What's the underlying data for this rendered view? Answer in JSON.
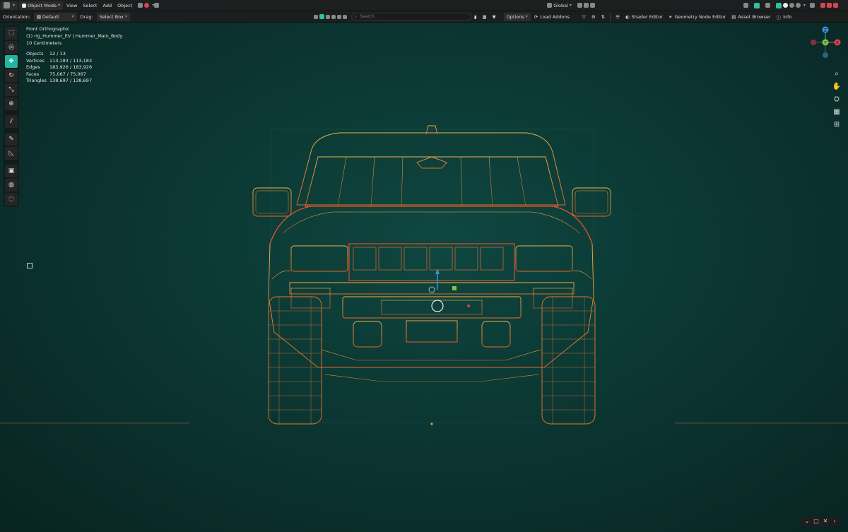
{
  "topbar": {
    "mode": "Object Mode",
    "menus": [
      "View",
      "Select",
      "Add",
      "Object"
    ],
    "transform_orientation": "Global"
  },
  "toolrow": {
    "orientation_label": "Orientation:",
    "orientation_value": "Default",
    "drag_label": "Drag:",
    "drag_value": "Select Box",
    "search_placeholder": "Search",
    "options_label": "Options",
    "load_addons": "Load Addons",
    "shader_editor": "Shader Editor",
    "geometry_node_editor": "Geometry Node Editor",
    "asset_browser": "Asset Browser",
    "info": "Info"
  },
  "overlay": {
    "view_name": "Front Orthographic",
    "object_path": "(1) rig_Hummer_EV | Hummer_Main_Body",
    "scale": "10 Centimeters"
  },
  "stats": [
    {
      "label": "Objects",
      "value": "12 / 13"
    },
    {
      "label": "Vertices",
      "value": "113,183 / 113,183"
    },
    {
      "label": "Edges",
      "value": "183,926 / 183,926"
    },
    {
      "label": "Faces",
      "value": "75,067 / 75,067"
    },
    {
      "label": "Triangles",
      "value": "138,697 / 138,697"
    }
  ],
  "gizmo_axes": {
    "x": "X",
    "y": "Y",
    "z": "Z"
  },
  "colors": {
    "accent": "#1fb5a0",
    "wire": "#f0a040",
    "wire_hot": "#e8542a",
    "x_axis": "#d94452",
    "y_axis": "#7ac943",
    "z_axis": "#3b8fd9"
  }
}
